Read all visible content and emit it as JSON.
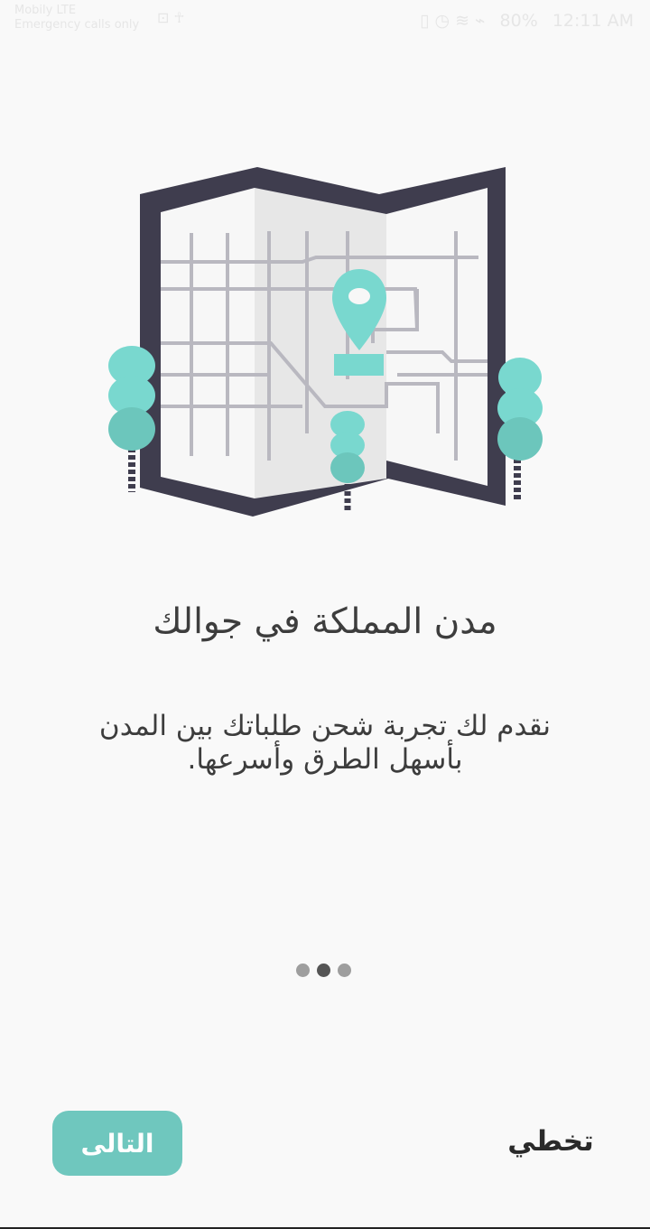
{
  "status_bar": {
    "carrier_line1": "Mobily LTE",
    "carrier_line2": "Emergency calls only",
    "left_icons": "⊡ ☥",
    "right_icons": "▯ ◷ ≋ ⌁",
    "battery": "80%",
    "time": "12:11 AM"
  },
  "onboarding": {
    "title": "مدن المملكة في جوالك",
    "description": "نقدم لك تجربة شحن طلباتك بين المدن بأسهل الطرق وأسرعها.",
    "pages_total": 3,
    "current_page": 2
  },
  "buttons": {
    "next_label": "التالى",
    "skip_label": "تخطي"
  },
  "colors": {
    "accent": "#6fc7be",
    "map_frame": "#3f3d4e",
    "tree": "#79d8cf",
    "text": "#3d3d3d"
  }
}
